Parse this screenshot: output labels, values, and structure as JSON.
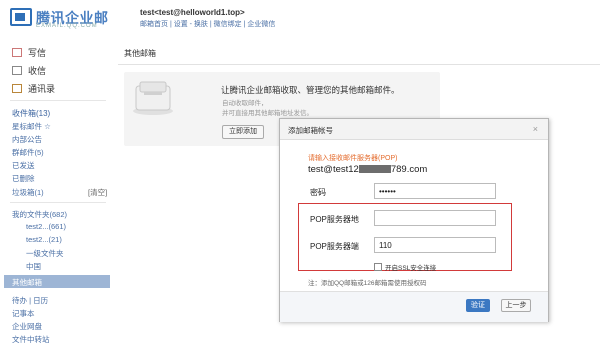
{
  "header": {
    "logo_text": "腾讯企业邮",
    "logo_sub": "EXMAIL.QQ.COM",
    "user_email": "test<test@helloworld1.top>",
    "links": "邮箱首页 | 设置 - 换肤 | 微信绑定 | 企业微信"
  },
  "sidebar": {
    "write": "写信",
    "receive": "收信",
    "contacts": "通讯录",
    "inbox": "收件箱(13)",
    "starred": "星标邮件 ☆",
    "internal": "内部公告",
    "groups": "群邮件(5)",
    "drafts": "已发送",
    "sent": "已删除",
    "spam": "垃圾箱(1)",
    "spam_clear": "[清空]",
    "my_folders": "我的文件夹(682)",
    "folder1": "test2...(661)",
    "folder2": "test2...(21)",
    "folder3": "一级文件夹",
    "folder4": "中国",
    "other_mail": "其他邮箱",
    "todo": "待办 | 日历",
    "notes": "记事本",
    "disk": "企业网盘",
    "transfer": "文件中转站"
  },
  "main": {
    "title": "其他邮箱",
    "promo_title": "让腾讯企业邮箱收取、管理您的其他邮箱邮件。",
    "promo_sub1": "自动收取邮件，",
    "promo_sub2": "并可直接用其他邮箱地址发信。",
    "add_button": "立即添加"
  },
  "dialog": {
    "title": "添加邮箱帐号",
    "close": "×",
    "hint": "请输入接收邮件服务器(POP)",
    "email_prefix": "test@test12",
    "email_suffix": "789.com",
    "password_label": "密码",
    "password_value": "••••••",
    "pop_server_label": "POP服务器地",
    "pop_server_value": "",
    "pop_port_label": "POP服务器端",
    "pop_port_value": "110",
    "ssl_label": "开启SSL安全连接",
    "note": "注：添加QQ邮箱或126邮箱需使用授权码",
    "verify_button": "验证",
    "prev_button": "上一步"
  },
  "colors": {
    "accent": "#3b78c2",
    "highlight": "#d23a3a",
    "hint": "#e46c2e",
    "sidebar_active": "#9db5d5"
  }
}
